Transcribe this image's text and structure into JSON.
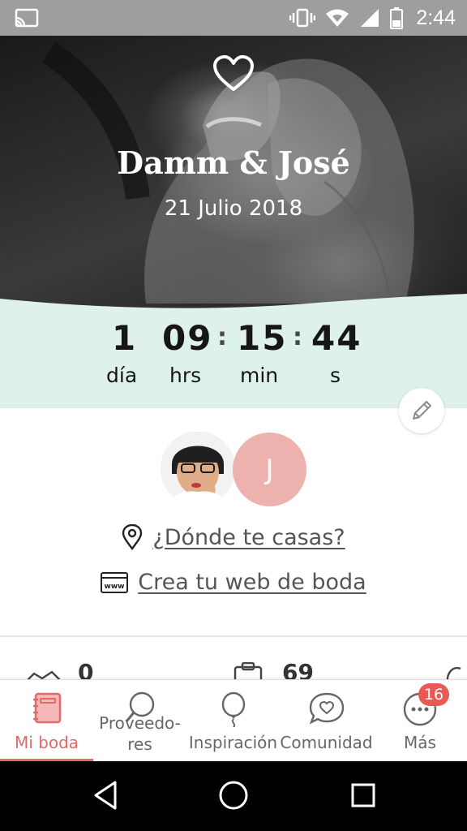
{
  "status_bar": {
    "time": "2:44",
    "icons": [
      "cast-icon",
      "vibrate-icon",
      "wifi-icon",
      "cell-signal-icon",
      "battery-icon"
    ]
  },
  "hero": {
    "title": "Damm & José",
    "date": "21 Julio 2018",
    "icon": "heart-icon"
  },
  "countdown": {
    "days": "1",
    "hours": "09",
    "minutes": "15",
    "seconds": "44",
    "separator": ":",
    "days_label": "día",
    "hours_label": "hrs",
    "minutes_label": "min",
    "seconds_label": "s",
    "background_color": "#dff1ec"
  },
  "couple": {
    "partner_initial": "J",
    "partner_color": "#edb2ae"
  },
  "links": {
    "where": "¿Dónde te casas?",
    "website": "Crea tu web de boda"
  },
  "stats_peek": {
    "left_value": "0",
    "middle_value": "69"
  },
  "bottom_nav": {
    "accent_color": "#e26a6a",
    "items": [
      {
        "label": "Mi boda",
        "icon": "notebook-icon",
        "active": true
      },
      {
        "label_line1": "Proveedo-",
        "label_line2": "res",
        "icon": "search-icon",
        "active": false
      },
      {
        "label": "Inspiración",
        "icon": "balloon-icon",
        "active": false
      },
      {
        "label": "Comunidad",
        "icon": "chat-heart-icon",
        "active": false
      },
      {
        "label": "Más",
        "icon": "more-icon",
        "badge": "16",
        "active": false
      }
    ]
  },
  "system_nav": [
    "back-icon",
    "home-icon",
    "recents-icon"
  ]
}
